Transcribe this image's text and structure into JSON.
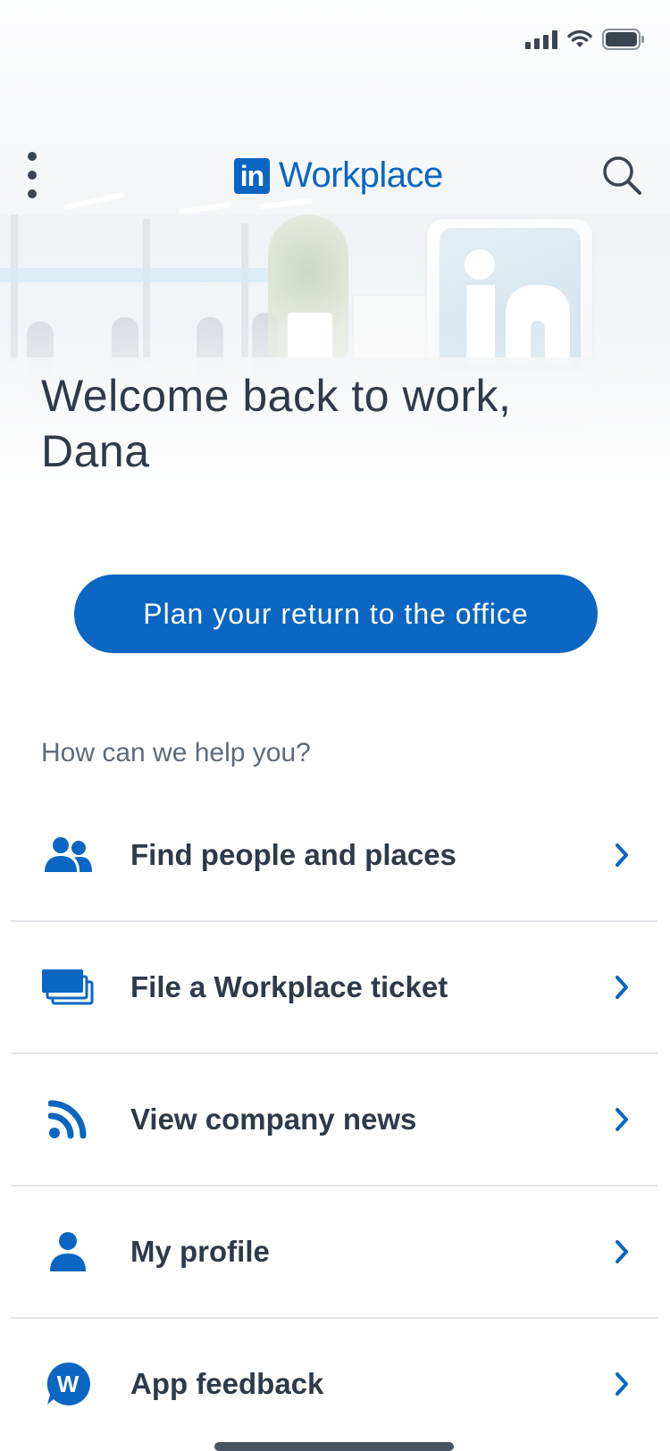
{
  "status_bar": {
    "signal": "cellular-signal-icon",
    "wifi": "wifi-icon",
    "battery": "battery-icon"
  },
  "header": {
    "menu_icon": "more-vertical-icon",
    "logo_mark": "in",
    "logo_text": "Workplace",
    "search_icon": "search-icon"
  },
  "hero": {
    "welcome": "Welcome back to work, Dana"
  },
  "cta": {
    "label": "Plan your return to the office"
  },
  "help_heading": "How can we help you?",
  "menu_items": [
    {
      "label": "Find people and places",
      "icon": "people-icon"
    },
    {
      "label": "File a Workplace ticket",
      "icon": "tickets-icon"
    },
    {
      "label": "View company news",
      "icon": "rss-icon"
    },
    {
      "label": "My profile",
      "icon": "person-icon"
    },
    {
      "label": "App feedback",
      "icon": "feedback-w-icon",
      "icon_letter": "W"
    }
  ],
  "colors": {
    "brand": "#0a66c2",
    "text": "#2f3a48",
    "muted": "#5e6b7a",
    "divider": "#e3e6ea"
  }
}
